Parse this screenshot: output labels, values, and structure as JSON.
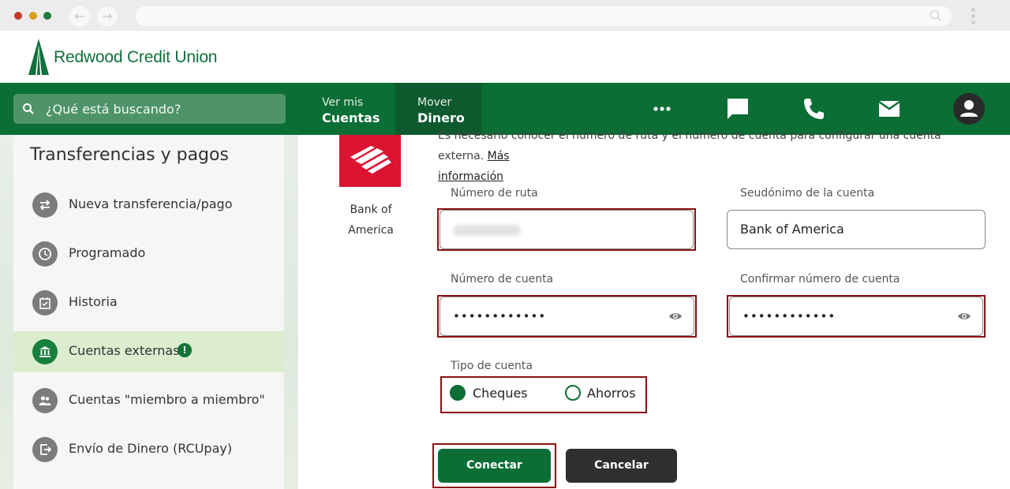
{
  "browser": {
    "back_glyph": "←",
    "forward_glyph": "→"
  },
  "header": {
    "brand": "Redwood Credit Union"
  },
  "topnav": {
    "search_placeholder": "¿Qué está buscando?",
    "tabs": [
      {
        "line1": "Ver mis",
        "line2": "Cuentas"
      },
      {
        "line1": "Mover",
        "line2": "Dinero"
      }
    ],
    "icons": [
      "more-icon",
      "chat-icon",
      "phone-icon",
      "mail-icon",
      "user-icon"
    ]
  },
  "sidebar": {
    "title": "Transferencias y pagos",
    "items": [
      {
        "label": "Nueva transferencia/pago",
        "icon": "transfer-icon"
      },
      {
        "label": "Programado",
        "icon": "clock-icon"
      },
      {
        "label": "Historia",
        "icon": "calendar-icon"
      },
      {
        "label": "Cuentas externas",
        "icon": "bank-icon",
        "active": true,
        "alert": "!"
      },
      {
        "label": "Cuentas \"miembro a miembro\"",
        "icon": "people-icon"
      },
      {
        "label": "Envío de Dinero (RCUpay)",
        "icon": "send-money-icon"
      }
    ]
  },
  "main": {
    "intro_text": "Es necesario conocer el número de ruta y el número de cuenta para configurar una cuenta externa.",
    "intro_link_1": "Más",
    "intro_link_2": "información",
    "bank_name": "Bank of America",
    "routing_label": "Número de ruta",
    "nickname_label": "Seudónimo de la cuenta",
    "nickname_value": "Bank of America",
    "account_label": "Número de cuenta",
    "account_value": "••••••••••••",
    "confirm_label": "Confirmar número de cuenta",
    "confirm_value": "••••••••••••",
    "account_type_label": "Tipo de cuenta",
    "account_types": [
      {
        "label": "Cheques",
        "selected": true
      },
      {
        "label": "Ahorros",
        "selected": false
      }
    ],
    "connect_button": "Conectar",
    "cancel_button": "Cancelar"
  },
  "colors": {
    "brand_green": "#0a6e35",
    "highlight_red": "#8a1212",
    "bank_red": "#dc1431"
  }
}
